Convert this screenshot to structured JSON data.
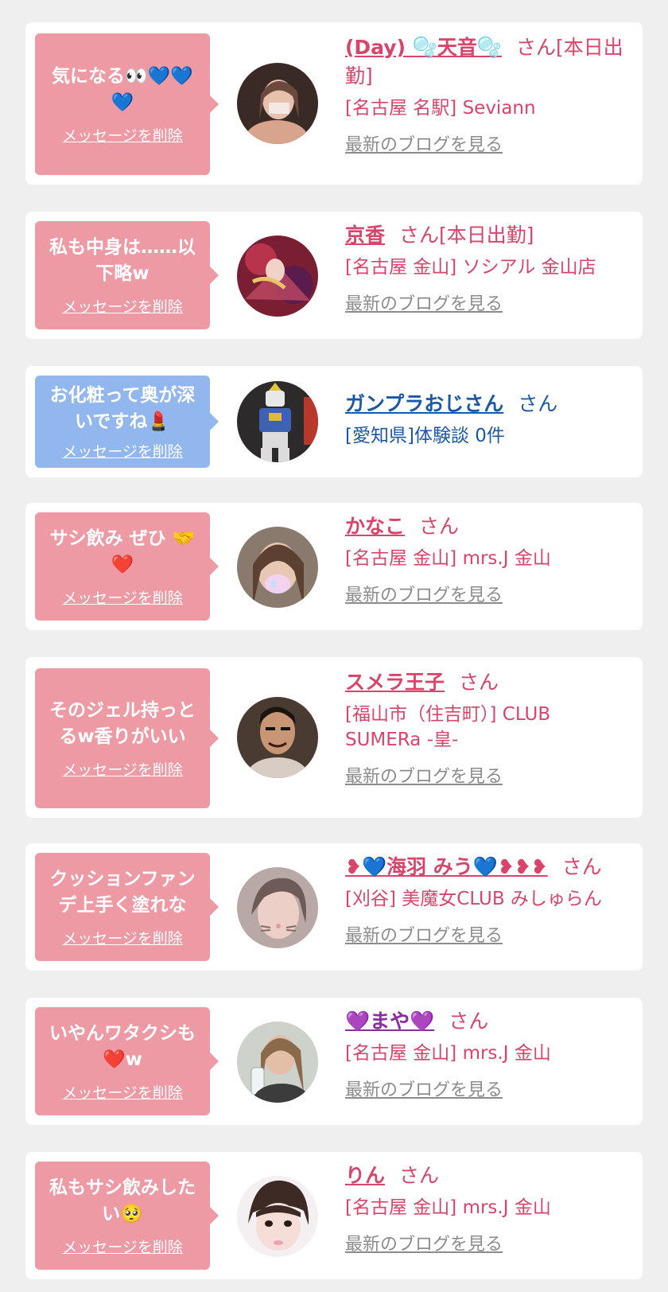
{
  "colors": {
    "pink": "#ee9aa5",
    "blue_bubble": "#92b6ee",
    "pink_text": "#d9456a",
    "blue_text": "#1c58a8",
    "gray_link": "#8c8c8c",
    "purple_text": "#8d2ba4"
  },
  "items": [
    {
      "bubble_text": "気になる👀💙💙💙",
      "delete_label": "メッセージを削除",
      "name": "(Day) 🫧天音🫧",
      "honorific": "さん[本日出勤]",
      "shop": "[名古屋 名駅] Seviann",
      "blog_label": "最新のブログを見る",
      "avatar": "woman-selfie-avatar"
    },
    {
      "bubble_text": "私も中身は……以下略w",
      "delete_label": "メッセージを削除",
      "name": "京香",
      "honorific": "さん[本日出勤]",
      "shop": "[名古屋 金山] ソシアル 金山店",
      "blog_label": "最新のブログを見る",
      "avatar": "kimono-avatar"
    },
    {
      "bubble_text": "お化粧って奥が深いですね💄",
      "delete_label": "メッセージを削除",
      "name": "ガンプラおじさん",
      "honorific": "さん",
      "shop": "[愛知県]体験談 0件",
      "blog_label": "",
      "avatar": "robot-model-avatar"
    },
    {
      "bubble_text": "サシ飲み ぜひ 🤝❤️",
      "delete_label": "メッセージを削除",
      "name": "かなこ",
      "honorific": "さん",
      "shop": "[名古屋 金山] mrs.J 金山",
      "blog_label": "最新のブログを見る",
      "avatar": "woman-mask-avatar"
    },
    {
      "bubble_text": "そのジェル持っとるw香りがいい",
      "delete_label": "メッセージを削除",
      "name": "スメラ王子",
      "honorific": "さん",
      "shop": "[福山市（住吉町）] CLUB SUMERa -皇-",
      "blog_label": "最新のブログを見る",
      "avatar": "man-makeup-avatar"
    },
    {
      "bubble_text": "クッションファンデ上手く塗れな",
      "delete_label": "メッセージを削除",
      "name": "❥💙海羽 みう💙❥❥❥",
      "honorific": "さん",
      "shop": "[刈谷] 美魔女CLUB みしゅらん",
      "blog_label": "最新のブログを見る",
      "avatar": "woman-cat-filter-avatar"
    },
    {
      "bubble_text": "いやんワタクシも❤️w",
      "delete_label": "メッセージを削除",
      "name": "💜まや💜",
      "honorific": "さん",
      "shop": "[名古屋 金山] mrs.J 金山",
      "blog_label": "最新のブログを見る",
      "avatar": "woman-drink-avatar"
    },
    {
      "bubble_text": "私もサシ飲みしたい🥺",
      "delete_label": "メッセージを削除",
      "name": "りん",
      "honorific": "さん",
      "shop": "[名古屋 金山] mrs.J 金山",
      "blog_label": "最新のブログを見る",
      "avatar": "woman-bangs-avatar"
    }
  ]
}
